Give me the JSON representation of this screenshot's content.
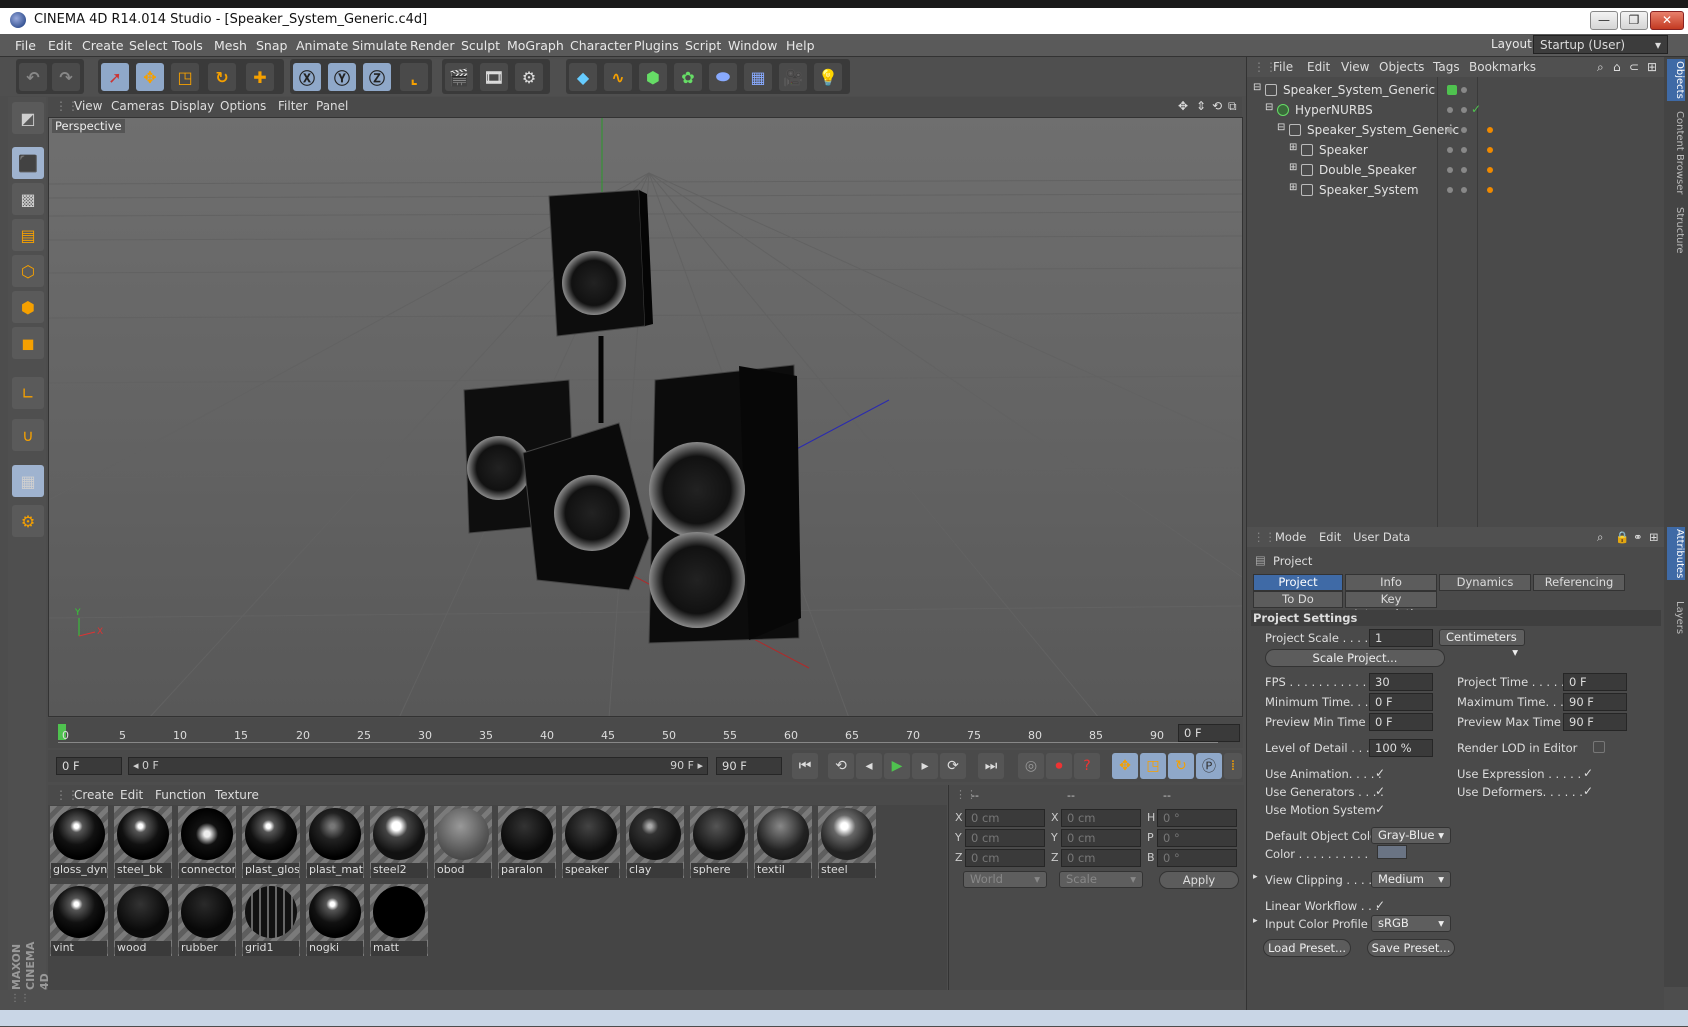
{
  "window": {
    "title": "CINEMA 4D R14.014 Studio - [Speaker_System_Generic.c4d]",
    "minimize": "—",
    "restore": "❐",
    "close": "✕"
  },
  "menu": [
    "File",
    "Edit",
    "Create",
    "Select",
    "Tools",
    "Mesh",
    "Snap",
    "Animate",
    "Simulate",
    "Render",
    "Sculpt",
    "MoGraph",
    "Character",
    "Plugins",
    "Script",
    "Window",
    "Help"
  ],
  "layout": {
    "label": "Layout:",
    "value": "Startup (User)"
  },
  "viewport": {
    "menu": [
      "View",
      "Cameras",
      "Display",
      "Options",
      "Filter",
      "Panel"
    ],
    "label": "Perspective"
  },
  "timeline": {
    "ticks": [
      "0",
      "5",
      "10",
      "15",
      "20",
      "25",
      "30",
      "35",
      "40",
      "45",
      "50",
      "55",
      "60",
      "65",
      "70",
      "75",
      "80",
      "85",
      "90"
    ],
    "current": "0 F",
    "start": "0 F",
    "range_start": "◂ 0 F",
    "range_end": "90 F ▸",
    "end": "90 F"
  },
  "materials": {
    "menu": [
      "Create",
      "Edit",
      "Function",
      "Texture"
    ],
    "items": [
      "gloss_dyn",
      "steel_bk",
      "connector_",
      "plast_gloss",
      "plast_matt",
      "steel2",
      "obod",
      "paralon",
      "speaker",
      "clay",
      "sphere",
      "textil",
      "steel",
      "vint",
      "wood",
      "rubber",
      "grid1",
      "nogki",
      "matt"
    ]
  },
  "coords": {
    "headers": [
      "--",
      "--",
      "--"
    ],
    "rows": [
      [
        "X",
        "0 cm",
        "X",
        "0 cm",
        "H",
        "0 °"
      ],
      [
        "Y",
        "0 cm",
        "Y",
        "0 cm",
        "P",
        "0 °"
      ],
      [
        "Z",
        "0 cm",
        "Z",
        "0 cm",
        "B",
        "0 °"
      ]
    ],
    "world": "World",
    "scale": "Scale",
    "apply": "Apply"
  },
  "objects": {
    "menu": [
      "File",
      "Edit",
      "View",
      "Objects",
      "Tags",
      "Bookmarks"
    ],
    "rows": [
      {
        "name": "Speaker_System_Generic",
        "indent": 0
      },
      {
        "name": "HyperNURBS",
        "indent": 1
      },
      {
        "name": "Speaker_System_Generic",
        "indent": 2
      },
      {
        "name": "Speaker",
        "indent": 3
      },
      {
        "name": "Double_Speaker",
        "indent": 3
      },
      {
        "name": "Speaker_System",
        "indent": 3
      }
    ]
  },
  "attributes": {
    "menu": [
      "Mode",
      "Edit",
      "User Data"
    ],
    "object": "Project",
    "tabs": [
      "Project Settings",
      "Info",
      "Dynamics",
      "Referencing"
    ],
    "tabs2": [
      "To Do",
      "Key Interpolation"
    ],
    "section": "Project Settings",
    "project_scale_label": "Project Scale . . . . . .",
    "project_scale": "1",
    "units": "Centimeters",
    "scale_project": "Scale Project...",
    "fps_label": "FPS . . . . . . . . . . . . . . .",
    "fps": "30",
    "project_time_label": "Project Time . . . . . . . .",
    "project_time": "0 F",
    "min_time_label": "Minimum Time. . . . .",
    "min_time": "0 F",
    "max_time_label": "Maximum Time. . . . . . .",
    "max_time": "90 F",
    "prev_min_label": "Preview Min Time . .",
    "prev_min": "0 F",
    "prev_max_label": "Preview Max Time . . . .",
    "prev_max": "90 F",
    "lod_label": "Level of Detail . . . . .",
    "lod": "100 %",
    "render_lod": "Render LOD in Editor",
    "use_animation": "Use Animation. . . . .",
    "use_expression": "Use Expression . . . . .",
    "use_generators": "Use Generators . . . .",
    "use_deformers": "Use Deformers. . . . . .",
    "use_motion": "Use Motion System",
    "default_color_label": "Default Object Color",
    "default_color": "Gray-Blue",
    "color_label": "Color . . . . . . . . . .",
    "view_clipping_label": "View Clipping . . . . . .",
    "view_clipping": "Medium",
    "linear_workflow": "Linear Workflow . . .",
    "input_profile_label": "Input Color Profile .",
    "input_profile": "sRGB",
    "load_preset": "Load Preset...",
    "save_preset": "Save Preset..."
  },
  "side_tabs": [
    "Objects",
    "Content Browser",
    "Structure",
    "Attributes",
    "Layers"
  ],
  "brand": "MAXON CINEMA 4D"
}
